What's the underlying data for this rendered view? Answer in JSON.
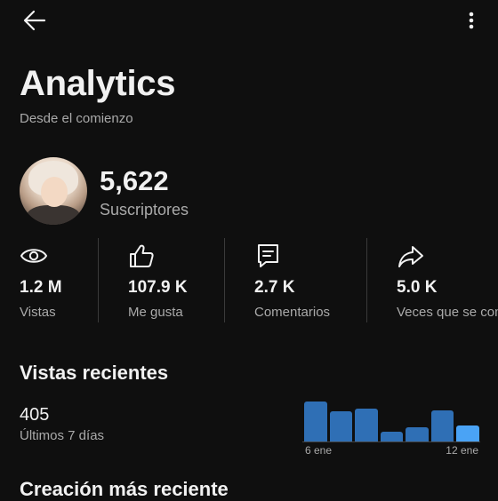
{
  "header": {
    "back_icon": "arrow-left-icon",
    "more_icon": "more-vertical-icon"
  },
  "page": {
    "title": "Analytics",
    "subtitle": "Desde el comienzo"
  },
  "channel": {
    "subscribers_value": "5,622",
    "subscribers_label": "Suscriptores"
  },
  "stats": [
    {
      "icon": "eye-icon",
      "value": "1.2 M",
      "label": "Vistas"
    },
    {
      "icon": "thumbs-up-icon",
      "value": "107.9 K",
      "label": "Me gusta"
    },
    {
      "icon": "comment-icon",
      "value": "2.7 K",
      "label": "Comentarios"
    },
    {
      "icon": "share-icon",
      "value": "5.0 K",
      "label": "Veces que se compartió"
    }
  ],
  "recent_views": {
    "title": "Vistas recientes",
    "value": "405",
    "label": "Últimos 7 días"
  },
  "chart_data": {
    "type": "bar",
    "x_labels": [
      "6 ene",
      "12 ene"
    ],
    "values": [
      46,
      35,
      38,
      12,
      17,
      36,
      19
    ],
    "ylim": [
      0,
      50
    ],
    "colors": {
      "main": "#2f6fb5",
      "last": "#4aa3f5"
    }
  },
  "next_section": {
    "title": "Creación más reciente"
  }
}
